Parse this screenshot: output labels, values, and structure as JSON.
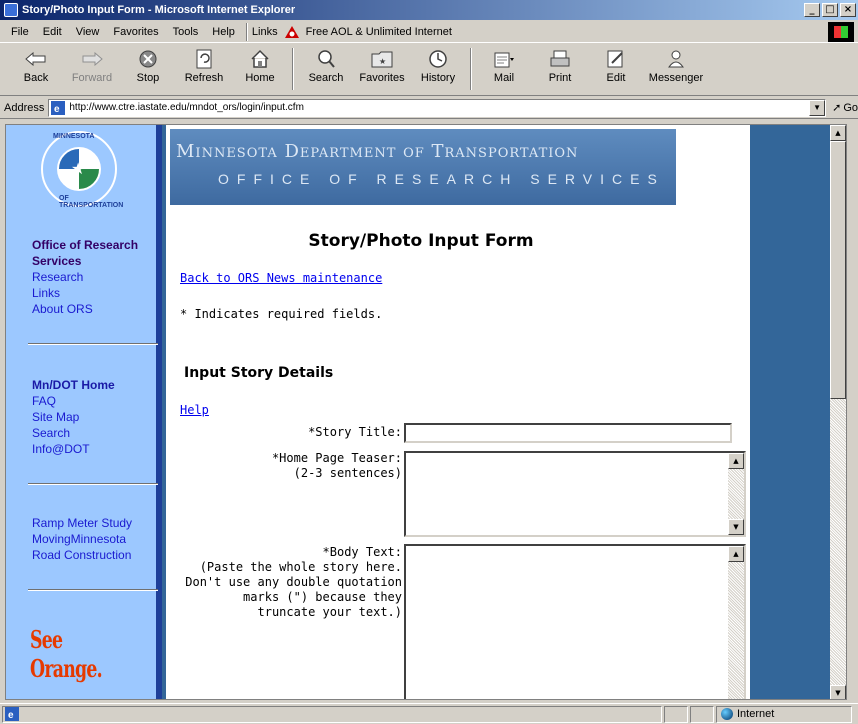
{
  "window": {
    "title": "Story/Photo Input Form - Microsoft Internet Explorer"
  },
  "menu": {
    "items": [
      "File",
      "Edit",
      "View",
      "Favorites",
      "Tools",
      "Help"
    ],
    "links_label": "Links",
    "aol_link": "Free AOL & Unlimited Internet"
  },
  "toolbar": {
    "back": "Back",
    "forward": "Forward",
    "stop": "Stop",
    "refresh": "Refresh",
    "home": "Home",
    "search": "Search",
    "favorites": "Favorites",
    "history": "History",
    "mail": "Mail",
    "print": "Print",
    "edit": "Edit",
    "messenger": "Messenger"
  },
  "address": {
    "label": "Address",
    "url": "http://www.ctre.iastate.edu/mndot_ors/login/input.cfm",
    "go": "Go"
  },
  "sidebar": {
    "seal_top": "MINNESOTA",
    "seal_bottom": "OF TRANSPORTATION",
    "group1": {
      "heading": "Office of Research Services",
      "links": [
        "Research",
        "Links",
        "About ORS"
      ]
    },
    "group2": {
      "heading": "Mn/DOT Home",
      "links": [
        "FAQ",
        "Site Map",
        "Search",
        "Info@DOT"
      ]
    },
    "group3": {
      "links": [
        "Ramp Meter Study",
        "MovingMinnesota",
        "Road Construction"
      ]
    },
    "promo": "See Orange."
  },
  "banner": {
    "line1": "Minnesota Department of Transportation",
    "line2": "OFFICE OF RESEARCH SERVICES"
  },
  "main": {
    "title": "Story/Photo Input Form",
    "back_link": "Back to ORS News maintenance",
    "required_note": "* Indicates required fields.",
    "section_heading": "Input Story Details",
    "help_link": "Help",
    "fields": {
      "story_title": "*Story Title:",
      "teaser": "*Home Page Teaser:\n(2-3 sentences)",
      "body": "*Body Text:\n(Paste the whole story here.\nDon't use any double quotation\nmarks (\") because they\ntruncate your text.)"
    }
  },
  "status": {
    "zone": "Internet"
  }
}
